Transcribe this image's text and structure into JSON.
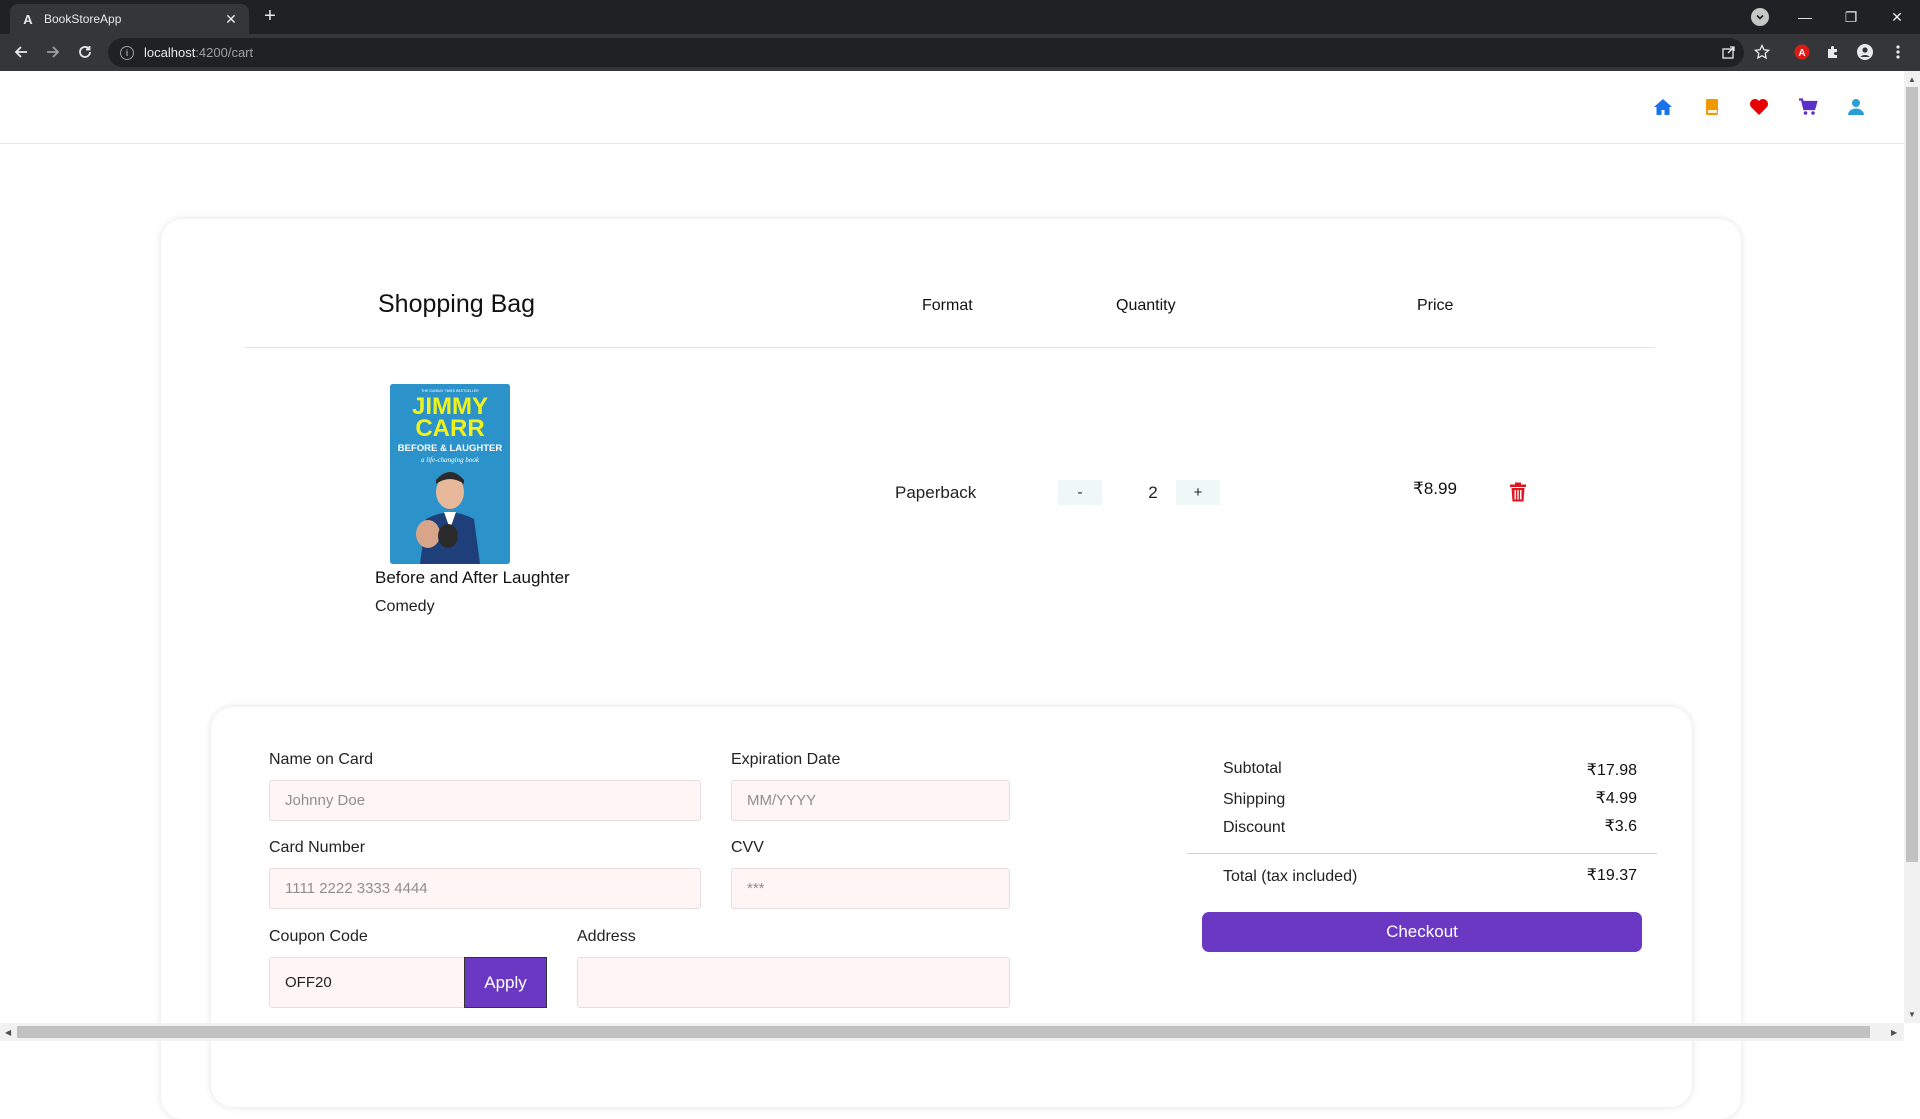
{
  "browser": {
    "tab_title": "BookStoreApp",
    "tab_favicon": "A",
    "tab_close": "✕",
    "new_tab": "+",
    "url_host": "localhost",
    "url_path": ":4200/cart",
    "window_controls": {
      "minimize": "—",
      "restore": "❐",
      "close": "✕"
    }
  },
  "nav": {
    "icons": [
      "home-icon",
      "book-icon",
      "heart-icon",
      "cart-icon",
      "user-icon"
    ],
    "colors": {
      "home": "#1a73e8",
      "book": "#f29900",
      "heart": "#e60000",
      "cart": "#5b2fc9",
      "user": "#2a9fd6"
    }
  },
  "cart": {
    "title": "Shopping Bag",
    "columns": {
      "format": "Format",
      "quantity": "Quantity",
      "price": "Price"
    },
    "items": [
      {
        "cover": {
          "tagline": "THE SUNDAY TIMES BESTSELLER",
          "author_line1": "JIMMY",
          "author_line2": "CARR",
          "title_line": "BEFORE & LAUGHTER",
          "subtitle": "a life-changing book"
        },
        "title": "Before and After Laughter",
        "genre": "Comedy",
        "format": "Paperback",
        "decrement": "-",
        "quantity": "2",
        "increment": "+",
        "price": "₹8.99"
      }
    ]
  },
  "payment": {
    "name_label": "Name on Card",
    "name_placeholder": "Johnny Doe",
    "exp_label": "Expiration Date",
    "exp_placeholder": "MM/YYYY",
    "card_label": "Card Number",
    "card_placeholder": "1111 2222 3333 4444",
    "cvv_label": "CVV",
    "cvv_placeholder": "***",
    "coupon_label": "Coupon Code",
    "coupon_value": "OFF20",
    "apply_label": "Apply",
    "address_label": "Address"
  },
  "summary": {
    "subtotal_label": "Subtotal",
    "subtotal_value": "₹17.98",
    "shipping_label": "Shipping",
    "shipping_value": "₹4.99",
    "discount_label": "Discount",
    "discount_value": "₹3.6",
    "total_label": "Total (tax included)",
    "total_value": "₹19.37",
    "checkout_label": "Checkout",
    "accent": "#6a38c2"
  }
}
